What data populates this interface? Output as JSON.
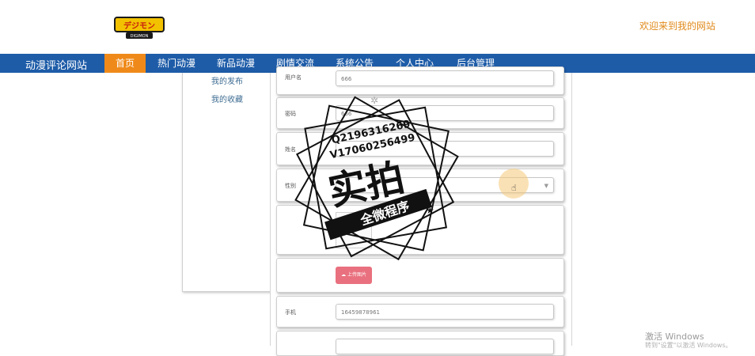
{
  "header": {
    "logo_text": "DIGIMON ADVENTURE",
    "welcome": "欢迎来到我的网站"
  },
  "navbar": {
    "brand": "动漫评论网站",
    "items": [
      "首页",
      "热门动漫",
      "新品动漫",
      "剧情交流",
      "系统公告",
      "个人中心",
      "后台管理"
    ],
    "active_index": 0
  },
  "sidebar": {
    "items": [
      "我的发布",
      "我的收藏"
    ]
  },
  "form": {
    "username": {
      "label": "用户名",
      "value": "666"
    },
    "password": {
      "label": "密码",
      "value": "666"
    },
    "name": {
      "label": "姓名",
      "value": ""
    },
    "gender": {
      "label": "性别",
      "value": ""
    },
    "upload_button": "上传图片",
    "phone": {
      "label": "手机",
      "value": "16459878961"
    }
  },
  "watermark": {
    "contact_q": "Q2196316269",
    "contact_v": "V17060256499",
    "big_text": "实拍",
    "banner": "全微程序"
  },
  "os_overlay": {
    "activate_title": "激活 Windows",
    "activate_sub": "转到\"设置\"以激活 Windows。"
  },
  "colors": {
    "nav_bg": "#1e5ca8",
    "nav_active": "#ef8a1a",
    "welcome_text": "#e08a1c",
    "upload_button": "#e9707e"
  }
}
